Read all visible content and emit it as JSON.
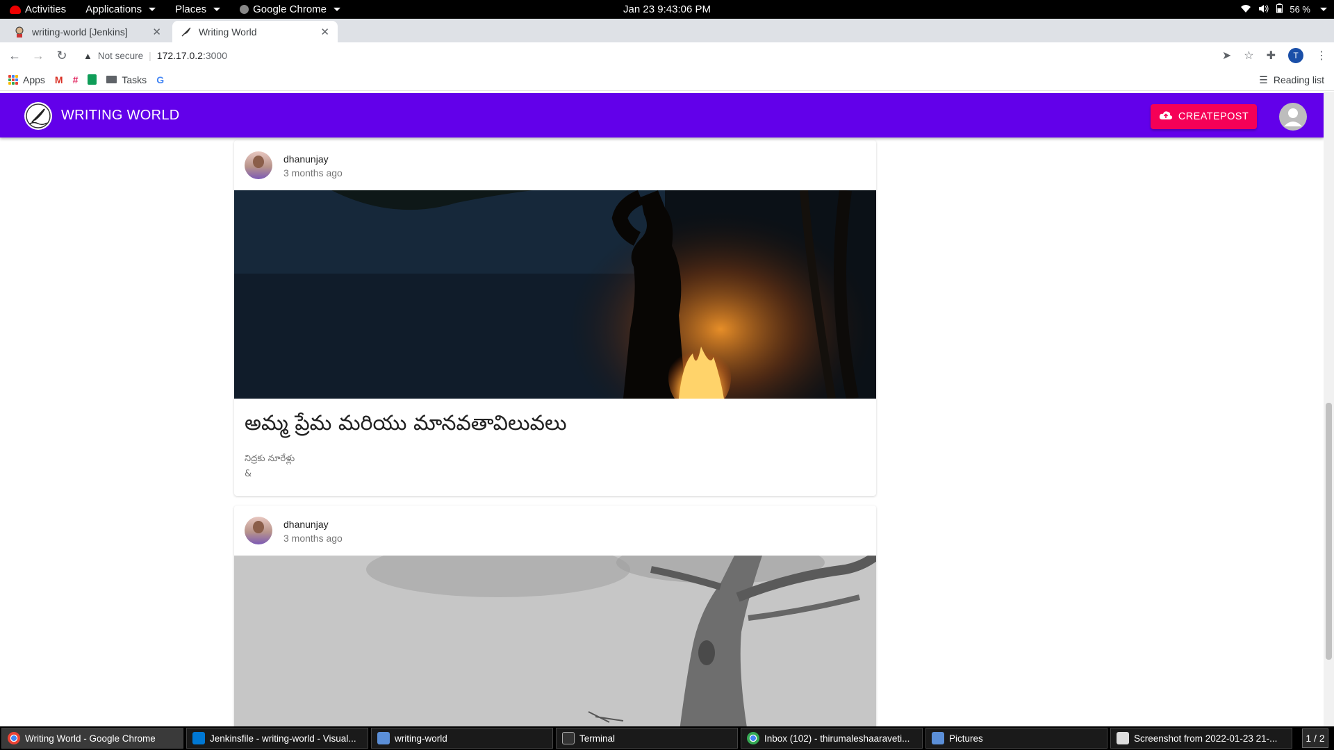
{
  "system_bar": {
    "activities": "Activities",
    "applications": "Applications",
    "places": "Places",
    "active_app": "Google Chrome",
    "clock": "Jan 23  9:43:06 PM",
    "battery": "56 %"
  },
  "browser": {
    "tabs": [
      {
        "title": "writing-world [Jenkins]"
      },
      {
        "title": "Writing World"
      }
    ],
    "url_security": "Not secure",
    "url_host": "172.17.0.2",
    "url_port": ":3000",
    "profile_initial": "T",
    "bookmarks": {
      "apps": "Apps",
      "tasks": "Tasks"
    },
    "reading_list": "Reading list"
  },
  "app": {
    "brand": "WRITING WORLD",
    "create_label": "CREATEPOST"
  },
  "posts": [
    {
      "author": "dhanunjay",
      "date": "3 months ago",
      "title": "అమ్మ ప్రేమ మరియు మానవతావిలువలు",
      "excerpt_line1": "నిద్రకు  నూరేళ్లు",
      "excerpt_line2": "&"
    },
    {
      "author": "dhanunjay",
      "date": "3 months ago"
    }
  ],
  "taskbar": {
    "items": [
      {
        "label": "Writing World - Google Chrome"
      },
      {
        "label": "Jenkinsfile - writing-world - Visual..."
      },
      {
        "label": "writing-world"
      },
      {
        "label": "Terminal"
      },
      {
        "label": "Inbox (102) - thirumaleshaaraveti..."
      },
      {
        "label": "Pictures"
      },
      {
        "label": "Screenshot from 2022-01-23 21-..."
      }
    ],
    "pager": "1 / 2"
  },
  "colors": {
    "appbar": "#6200ea",
    "create_button": "#f50057"
  }
}
